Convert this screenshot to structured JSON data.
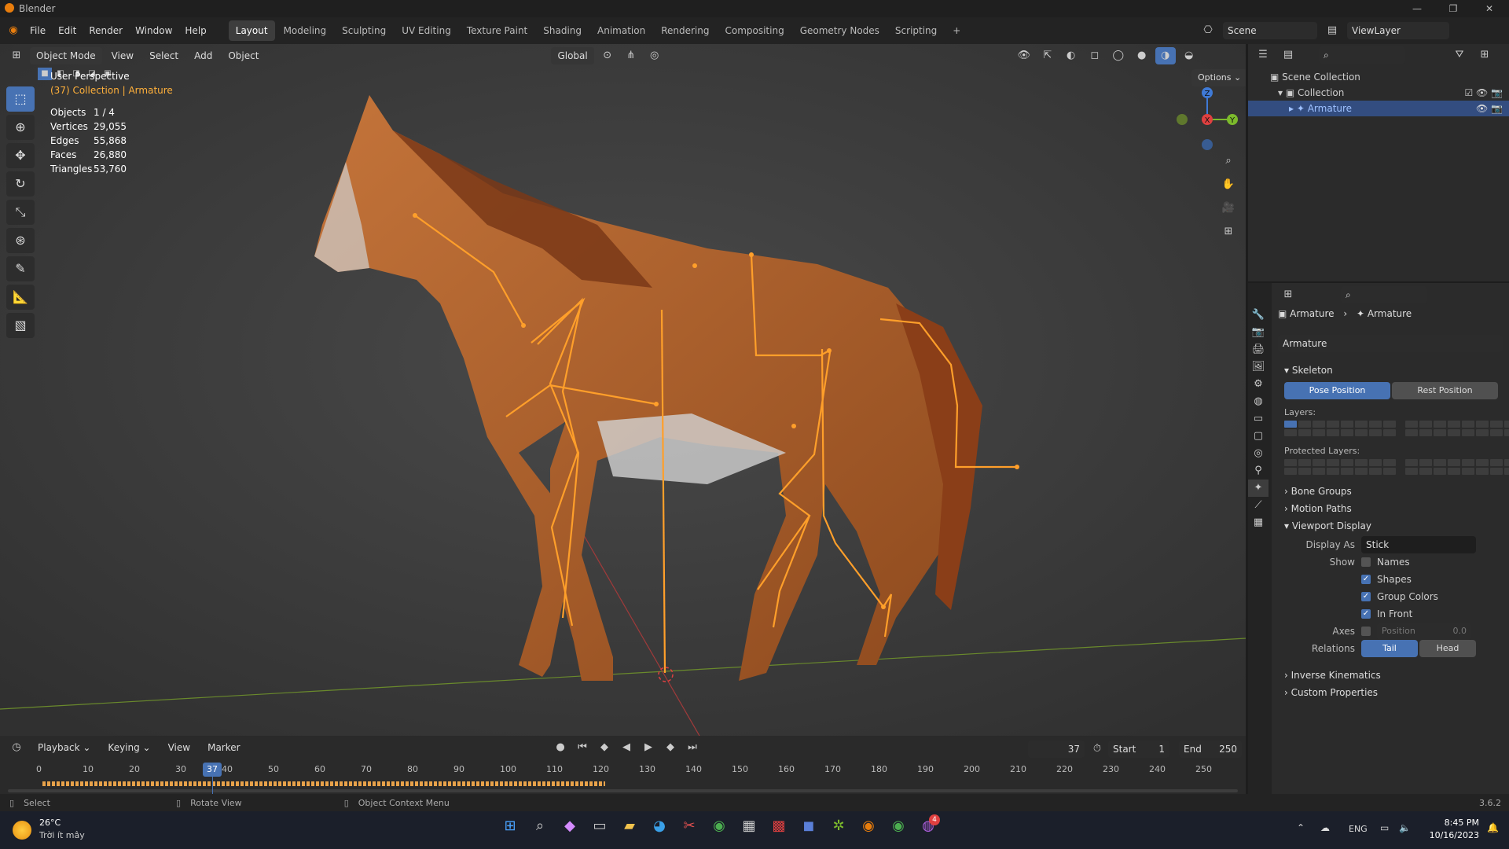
{
  "window": {
    "title": "Blender",
    "min": "—",
    "max": "❐",
    "close": "✕"
  },
  "menu": [
    "File",
    "Edit",
    "Render",
    "Window",
    "Help"
  ],
  "workspaces": [
    "Layout",
    "Modeling",
    "Sculpting",
    "UV Editing",
    "Texture Paint",
    "Shading",
    "Animation",
    "Rendering",
    "Compositing",
    "Geometry Nodes",
    "Scripting"
  ],
  "scene": {
    "label": "Scene",
    "viewlayer": "ViewLayer"
  },
  "viewport": {
    "mode": "Object Mode",
    "menus": [
      "View",
      "Select",
      "Add",
      "Object"
    ],
    "transform": "Global",
    "options": "Options ⌄",
    "perspective": "User Perspective",
    "collection": "(37) Collection | Armature",
    "stats": [
      {
        "k": "Objects",
        "v": "1 / 4"
      },
      {
        "k": "Vertices",
        "v": "29,055"
      },
      {
        "k": "Edges",
        "v": "55,868"
      },
      {
        "k": "Faces",
        "v": "26,880"
      },
      {
        "k": "Triangles",
        "v": "53,760"
      }
    ],
    "gizmo": {
      "z": "Z",
      "x": "X",
      "y": "Y"
    }
  },
  "timeline": {
    "menus": [
      "Playback ⌄",
      "Keying ⌄",
      "View",
      "Marker"
    ],
    "current": "37",
    "start_label": "Start",
    "start": "1",
    "end_label": "End",
    "end": "250",
    "ticks": [
      "0",
      "10",
      "20",
      "30",
      "40",
      "50",
      "60",
      "70",
      "80",
      "90",
      "100",
      "110",
      "120",
      "130",
      "140",
      "150",
      "160",
      "170",
      "180",
      "190",
      "200",
      "210",
      "220",
      "230",
      "240",
      "250"
    ],
    "frame_badge": "37"
  },
  "statusbar": {
    "select": "Select",
    "rotate": "Rotate View",
    "context": "Object Context Menu",
    "version": "3.6.2"
  },
  "outliner": {
    "scene_collection": "Scene Collection",
    "collection": "Collection",
    "armature": "Armature"
  },
  "properties": {
    "breadcrumb": [
      "Armature",
      "Armature"
    ],
    "datablock": "Armature",
    "skeleton": "Skeleton",
    "pose_position": "Pose Position",
    "rest_position": "Rest Position",
    "layers": "Layers:",
    "protected_layers": "Protected Layers:",
    "bone_groups": "Bone Groups",
    "motion_paths": "Motion Paths",
    "viewport_display": "Viewport Display",
    "display_as_label": "Display As",
    "display_as": "Stick",
    "show_label": "Show",
    "names": "Names",
    "shapes": "Shapes",
    "group_colors": "Group Colors",
    "in_front": "In Front",
    "axes_label": "Axes",
    "position_label": "Position",
    "position_value": "0.0",
    "relations_label": "Relations",
    "tail": "Tail",
    "head": "Head",
    "ik": "Inverse Kinematics",
    "custom_props": "Custom Properties"
  },
  "taskbar": {
    "temp": "26°C",
    "weather": "Trời ít mây",
    "lang": "ENG",
    "time": "8:45 PM",
    "date": "10/16/2023",
    "badge": "4"
  },
  "colors": {
    "accent": "#4772b3",
    "bone": "#ff9f2a",
    "horse": "#b0602a",
    "selected_text": "#ffb03a"
  }
}
